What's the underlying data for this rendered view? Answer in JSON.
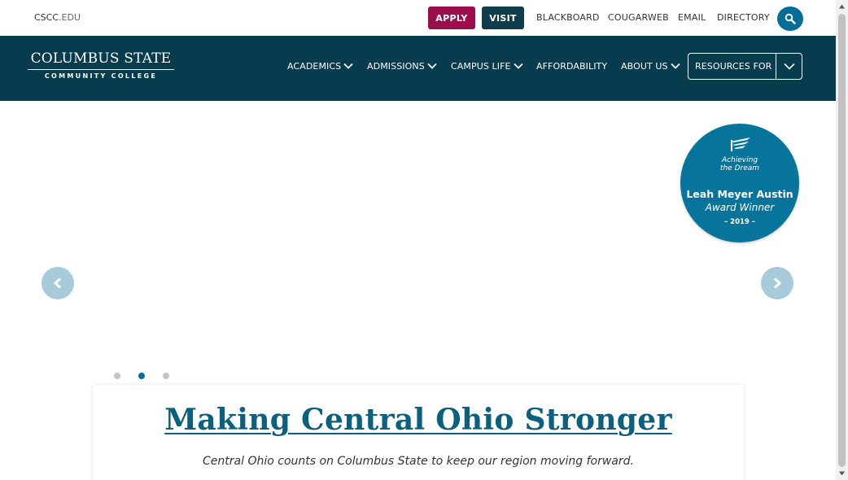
{
  "utility_bar": {
    "site_prefix": "CSCC",
    "site_suffix": ".EDU",
    "apply_label": "APPLY",
    "visit_label": "VISIT",
    "links": [
      "BLACKBOARD",
      "COUGARWEB",
      "EMAIL",
      "DIRECTORY"
    ],
    "search_icon": "search-icon"
  },
  "header": {
    "logo_line1": "COLUMBUS STATE",
    "logo_line2": "COMMUNITY COLLEGE",
    "nav": [
      "ACADEMICS",
      "ADMISSIONS",
      "CAMPUS LIFE",
      "AFFORDABILITY",
      "ABOUT US"
    ],
    "resources_label": "RESOURCES FOR"
  },
  "hero": {
    "badge": {
      "line1": "Achieving",
      "line2": "the Dream",
      "winner": "Leah Meyer Austin",
      "award": "Award Winner",
      "year": "– 2019 –"
    },
    "slides": {
      "count": 3,
      "active": 2
    },
    "title": "Making Central Ohio Stronger",
    "subtitle": "Central Ohio counts on Columbus State to keep our region moving forward."
  },
  "colors": {
    "brand_dark": "#063c4d",
    "apply": "#9b0d4c",
    "visit": "#0f3d4c",
    "accent": "#006e96",
    "title": "#0b607e"
  }
}
